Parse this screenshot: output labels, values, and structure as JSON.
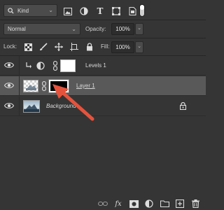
{
  "filter": {
    "kind_label": "Kind",
    "icons": [
      "pixel-filter-icon",
      "adjustment-filter-icon",
      "type-filter-icon",
      "shape-filter-icon",
      "smart-object-filter-icon"
    ],
    "type_glyph": "T"
  },
  "blend": {
    "mode": "Normal",
    "opacity_label": "Opacity:",
    "opacity_value": "100%"
  },
  "lock": {
    "label": "Lock:",
    "fill_label": "Fill:",
    "fill_value": "100%"
  },
  "layers": [
    {
      "name": "Levels 1",
      "visible": true,
      "type": "adjustment",
      "selected": false
    },
    {
      "name": "Layer 1",
      "visible": true,
      "type": "masked",
      "selected": true
    },
    {
      "name": "Background",
      "visible": true,
      "type": "background",
      "selected": false,
      "locked": true
    }
  ],
  "bottom_bar": {
    "fx_label": "fx",
    "icons": [
      "link-icon",
      "fx-icon",
      "add-mask-icon",
      "adjustment-layer-icon",
      "group-folder-icon",
      "new-layer-icon",
      "trash-icon"
    ]
  },
  "colors": {
    "panel_bg": "#353535",
    "selected_row": "#595959",
    "annotation_arrow": "#e5533d"
  }
}
